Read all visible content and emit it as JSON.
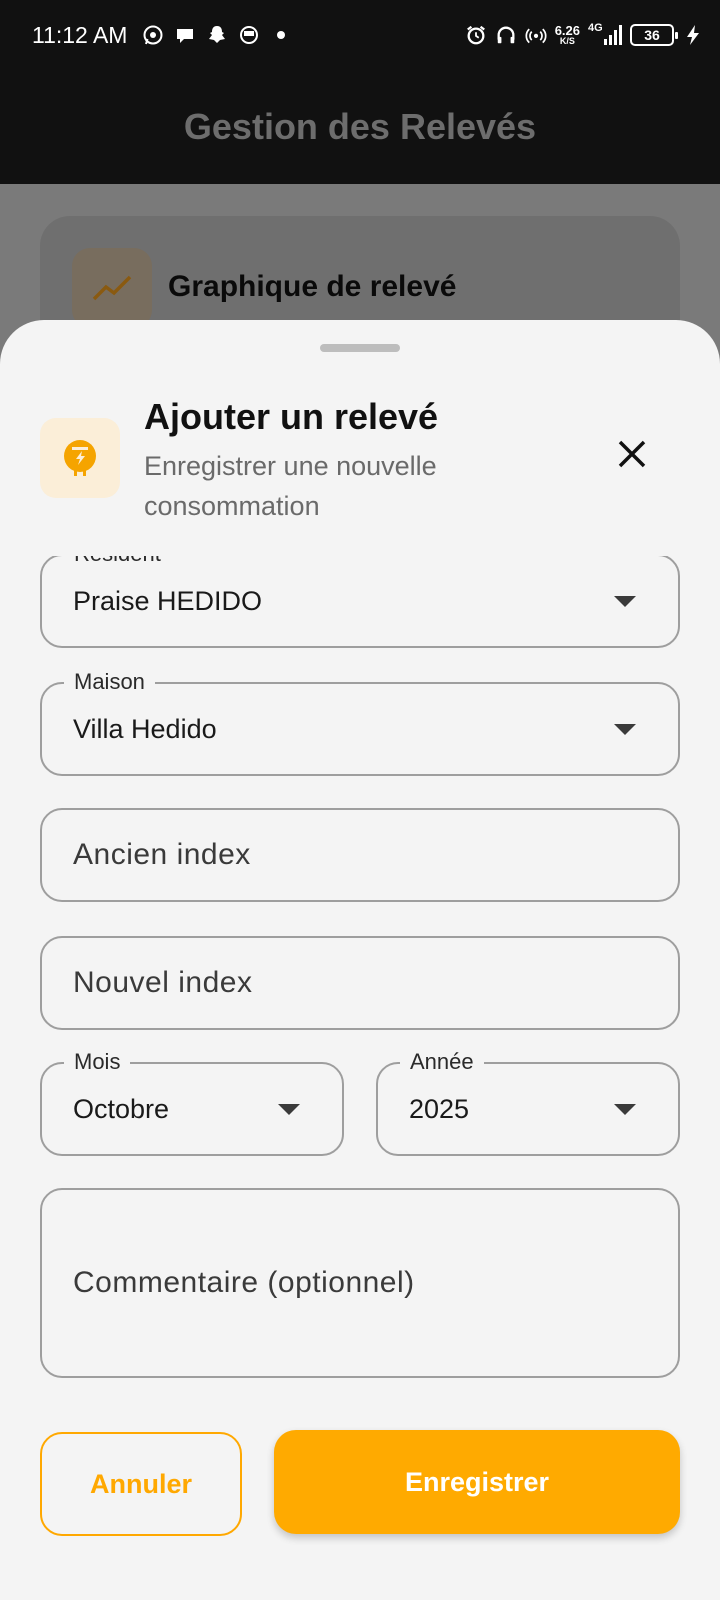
{
  "status_bar": {
    "time": "11:12 AM",
    "net_speed_value": "6.26",
    "net_speed_unit": "K/S",
    "network_type": "4G",
    "battery_level": "36"
  },
  "app_bar": {
    "title": "Gestion des Relevés"
  },
  "background": {
    "card_title": "Graphique de relevé"
  },
  "sheet": {
    "title": "Ajouter un relevé",
    "subtitle": "Enregistrer une nouvelle consommation",
    "fields": {
      "resident": {
        "label": "Résident",
        "value": "Praise HEDIDO"
      },
      "maison": {
        "label": "Maison",
        "value": "Villa Hedido"
      },
      "ancien_index": {
        "placeholder": "Ancien index"
      },
      "nouvel_index": {
        "placeholder": "Nouvel index"
      },
      "mois": {
        "label": "Mois",
        "value": "Octobre"
      },
      "annee": {
        "label": "Année",
        "value": "2025"
      },
      "commentaire": {
        "placeholder": "Commentaire (optionnel)"
      }
    },
    "buttons": {
      "cancel_label": "Annuler",
      "save_label": "Enregistrer"
    }
  },
  "colors": {
    "accent": "#ffaa00",
    "status_bar_bg": "#111111",
    "sheet_bg": "#f4f4f4"
  }
}
